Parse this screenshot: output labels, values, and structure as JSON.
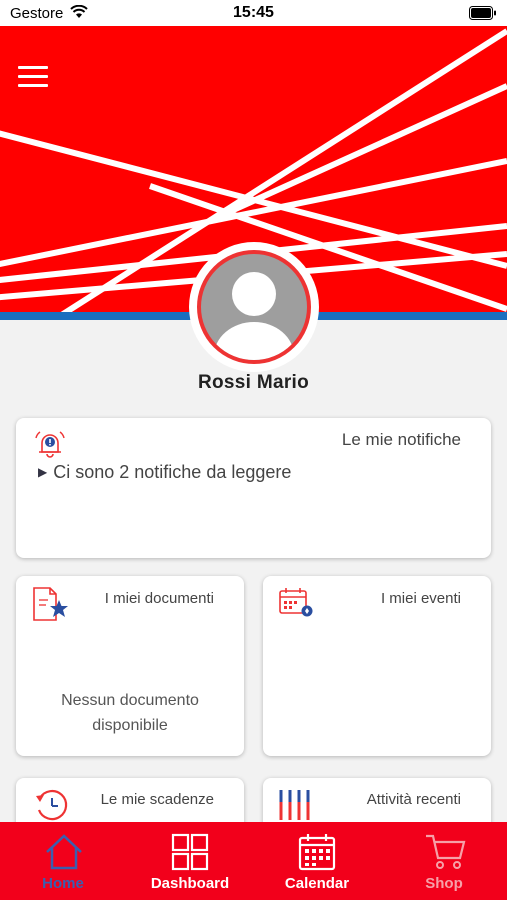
{
  "status_bar": {
    "carrier": "Gestore",
    "time": "15:45"
  },
  "profile": {
    "name": "Rossi Mario"
  },
  "notifications": {
    "title": "Le mie notifiche",
    "message": "Ci sono 2 notifiche da leggere"
  },
  "documents": {
    "title": "I miei documenti",
    "empty_message_line1": "Nessun documento",
    "empty_message_line2": "disponibile"
  },
  "events": {
    "title": "I miei eventi"
  },
  "deadlines": {
    "title": "Le mie scadenze"
  },
  "recent": {
    "title": "Attività recenti"
  },
  "nav": {
    "items": [
      {
        "label": "Home",
        "icon": "home-icon",
        "active": true
      },
      {
        "label": "Dashboard",
        "icon": "dashboard-icon",
        "active": false
      },
      {
        "label": "Calendar",
        "icon": "calendar-icon",
        "active": false
      },
      {
        "label": "Shop",
        "icon": "cart-icon",
        "active": false
      }
    ]
  },
  "colors": {
    "brand_red": "#ff0000",
    "nav_red": "#f2001b",
    "accent_blue": "#1a6fbf",
    "active_nav": "#3a5fb0",
    "disabled_nav": "#f6a0a8"
  }
}
